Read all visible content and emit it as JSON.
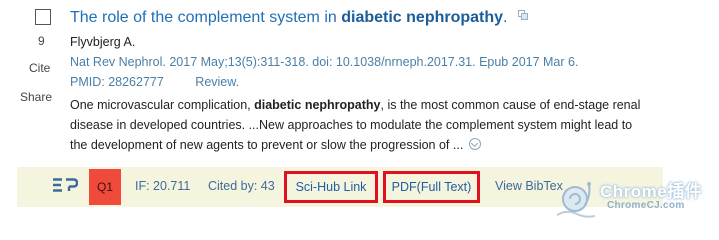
{
  "article": {
    "title_prefix": "The role of the complement system in ",
    "title_bold": "diabetic nephropathy",
    "title_suffix": ".",
    "authors": "Flyvbjerg A.",
    "citation": "Nat Rev Nephrol. 2017 May;13(5):311-318. doi: 10.1038/nrneph.2017.31. Epub 2017 Mar 6.",
    "pmid": "PMID: 28262777",
    "type": "Review.",
    "snippet_pre": "One microvascular complication, ",
    "snippet_bold": "diabetic nephropathy",
    "snippet_post": ", is the most common cause of end-stage renal disease in developed countries. ...New approaches to modulate the complement system might lead to the development of new agents to prevent or slow the progression of ... "
  },
  "sidebar": {
    "cite_count": "9",
    "cite_label": "Cite",
    "share_label": "Share"
  },
  "extension_bar": {
    "logo_text": "EP",
    "quartile": "Q1",
    "impact_factor": "IF: 20.711",
    "cited_by": "Cited by: 43",
    "scihub_label": "Sci-Hub Link",
    "pdf_label": "PDF(Full Text)",
    "bibtex_label": "View BibTex"
  },
  "watermark": {
    "title": "Chrome插件",
    "subtitle": "ChromeCJ.com"
  },
  "colors": {
    "title_blue": "#1f6fb5",
    "link_blue": "#4a7fa8",
    "bar_background": "#f4f4df",
    "quartile_red": "#f04a3a",
    "highlight_red": "#e0101e"
  }
}
